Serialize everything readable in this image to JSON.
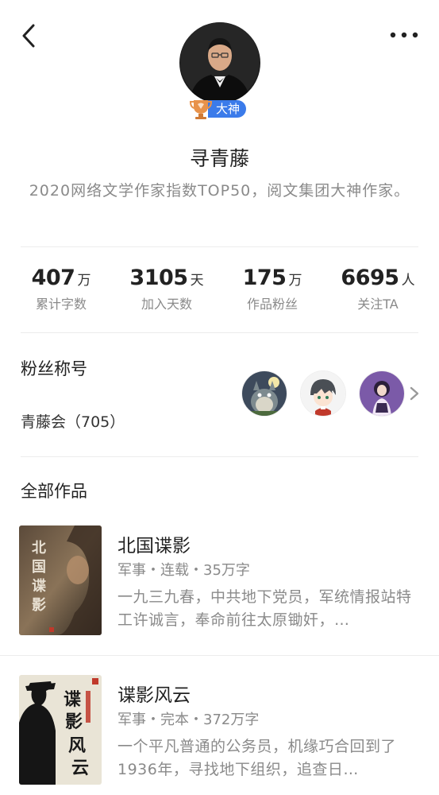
{
  "header": {
    "back_icon": "chevron-left-icon",
    "more_icon": "more-dots-icon"
  },
  "author": {
    "badge_label": "大神",
    "name": "寻青藤",
    "description": "2020网络文学作家指数TOP50，阅文集团大神作家。"
  },
  "stats": [
    {
      "value": "407",
      "unit": "万",
      "label": "累计字数"
    },
    {
      "value": "3105",
      "unit": "天",
      "label": "加入天数"
    },
    {
      "value": "175",
      "unit": "万",
      "label": "作品粉丝"
    },
    {
      "value": "6695",
      "unit": "人",
      "label": "关注TA"
    }
  ],
  "fans": {
    "title": "粉丝称号",
    "group_name": "青藤会（705）"
  },
  "works": {
    "title": "全部作品",
    "books": [
      {
        "title": "北国谍影",
        "meta": "军事・连载・35万字",
        "description": "一九三九春，中共地下党员，军统情报站特工许诚言，奉命前往太原锄奸，…",
        "cover_text": "北国谍影"
      },
      {
        "title": "谍影风云",
        "meta": "军事・完本・372万字",
        "description": "一个平凡普通的公务员，机缘巧合回到了1936年，寻找地下组织，追查日…",
        "cover_text": "谍影风云"
      }
    ]
  },
  "colors": {
    "badge_blue": "#3b7bea",
    "text_gray": "#8a8a8a"
  }
}
